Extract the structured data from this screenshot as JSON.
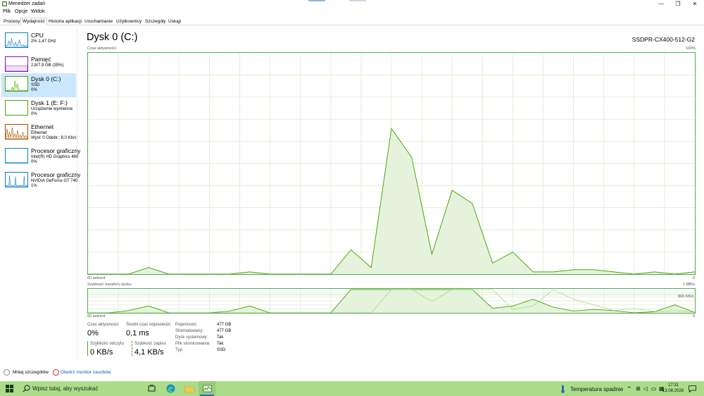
{
  "window": {
    "title": "Menedżer zadań",
    "buttons": {
      "minimize": "—",
      "restore": "❐",
      "close": "✕"
    }
  },
  "menu": [
    "Plik",
    "Opcje",
    "Widok"
  ],
  "tabs": [
    "Procesy",
    "Wydajność",
    "Historia aplikacji",
    "Uruchamianie",
    "Użytkownicy",
    "Szczegóły",
    "Usługi"
  ],
  "active_tab": "Wydajność",
  "sidebar": [
    {
      "name": "CPU",
      "sub1": "2% 1,47 GHz",
      "sub2": "",
      "color": "#117dbb"
    },
    {
      "name": "Pamięć",
      "sub1": "2,8/7,9 GB (35%)",
      "sub2": "",
      "color": "#8b12ae"
    },
    {
      "name": "Dysk 0 (C:)",
      "sub1": "SSD",
      "sub2": "0%",
      "color": "#4da60c"
    },
    {
      "name": "Dysk 1 (E: F:)",
      "sub1": "Urządzenie wymienne",
      "sub2": "0%",
      "color": "#4da60c"
    },
    {
      "name": "Ethernet",
      "sub1": "Ethernet",
      "sub2": "Wysł: 0 Odebr.: 8,0 Kb/s",
      "color": "#a74f01"
    },
    {
      "name": "Procesor graficzny",
      "sub1": "Intel(R) HD Graphics 460",
      "sub2": "0%",
      "color": "#117dbb"
    },
    {
      "name": "Procesor graficzny",
      "sub1": "NVIDIA GeForce GT 740",
      "sub2": "1%",
      "color": "#117dbb"
    }
  ],
  "main": {
    "title": "Dysk 0 (C:)",
    "model": "SSDPR-CX400-512-G2",
    "active_time_label": "Czas aktywności",
    "active_time_max": "100%",
    "seconds_label": "60 sekund",
    "zero": "0",
    "transfer_label": "Szybkość transferu dysku",
    "transfer_max": "1 MB/s",
    "transfer_mid": "800 KB/s"
  },
  "chart_data": [
    {
      "type": "area",
      "title": "Czas aktywności",
      "xlabel": "60 sekund",
      "ylim": [
        0,
        100
      ],
      "x": [
        60,
        58,
        56,
        54,
        52,
        50,
        48,
        46,
        44,
        42,
        40,
        38,
        36,
        34,
        32,
        30,
        28,
        26,
        24,
        22,
        20,
        18,
        16,
        14,
        12,
        10,
        8,
        6,
        4,
        2,
        0
      ],
      "values": [
        0,
        0,
        0,
        3,
        0,
        0,
        0,
        0,
        1,
        0,
        0,
        0,
        0,
        11,
        3,
        66,
        53,
        9,
        38,
        32,
        5,
        10,
        1,
        1,
        2,
        2,
        1,
        0,
        1,
        0,
        1
      ]
    },
    {
      "type": "line",
      "title": "Szybkość transferu dysku",
      "xlabel": "60 sekund",
      "ylabel": "KB/s",
      "ylim": [
        0,
        1024
      ],
      "x": [
        60,
        58,
        56,
        54,
        52,
        50,
        48,
        46,
        44,
        42,
        40,
        38,
        36,
        34,
        32,
        30,
        28,
        26,
        24,
        22,
        20,
        18,
        16,
        14,
        12,
        10,
        8,
        6,
        4,
        2,
        0
      ],
      "series": [
        {
          "name": "Szybkość odczytu",
          "values": [
            0,
            0,
            100,
            300,
            0,
            0,
            0,
            80,
            300,
            0,
            0,
            0,
            0,
            1024,
            1024,
            1024,
            1024,
            1024,
            1024,
            1024,
            200,
            300,
            600,
            250,
            80,
            150,
            100,
            0,
            50,
            350,
            20
          ]
        },
        {
          "name": "Szybkość zapisu",
          "values": [
            0,
            0,
            0,
            0,
            0,
            0,
            0,
            0,
            0,
            0,
            0,
            0,
            0,
            0,
            0,
            1024,
            1024,
            500,
            1024,
            1024,
            1024,
            150,
            300,
            1024,
            600,
            350,
            100,
            200,
            60,
            100,
            30
          ]
        }
      ]
    }
  ],
  "stats": {
    "active_time": {
      "label": "Czas aktywności",
      "value": "0%"
    },
    "avg_response": {
      "label": "Średni czas odpowiedzi",
      "value": "0,1 ms"
    },
    "read_speed": {
      "label": "Szybkość odczytu",
      "value": "0 KB/s",
      "color": "#4da60c"
    },
    "write_speed": {
      "label": "Szybkość zapisu",
      "value": "4,1 KB/s",
      "color": "#4da60c"
    },
    "props": [
      {
        "key": "Pojemność:",
        "value": "477 GB"
      },
      {
        "key": "Sformatowany:",
        "value": "477 GB"
      },
      {
        "key": "Dysk systemowy:",
        "value": "Tak"
      },
      {
        "key": "Plik stronicowania:",
        "value": "Tak"
      },
      {
        "key": "Typ:",
        "value": "SSD"
      }
    ]
  },
  "footer": {
    "less_details": "Mniej szczegółów",
    "resource_monitor": "Otwórz monitor zasobów"
  },
  "taskbar": {
    "search_placeholder": "Wpisz tutaj, aby wyszukać",
    "weather": "Temperatura spadnie",
    "time": "17:31",
    "date": "13.08.2026",
    "icons": [
      "task-view-icon",
      "edge-icon",
      "file-explorer-icon",
      "task-manager-icon"
    ]
  }
}
